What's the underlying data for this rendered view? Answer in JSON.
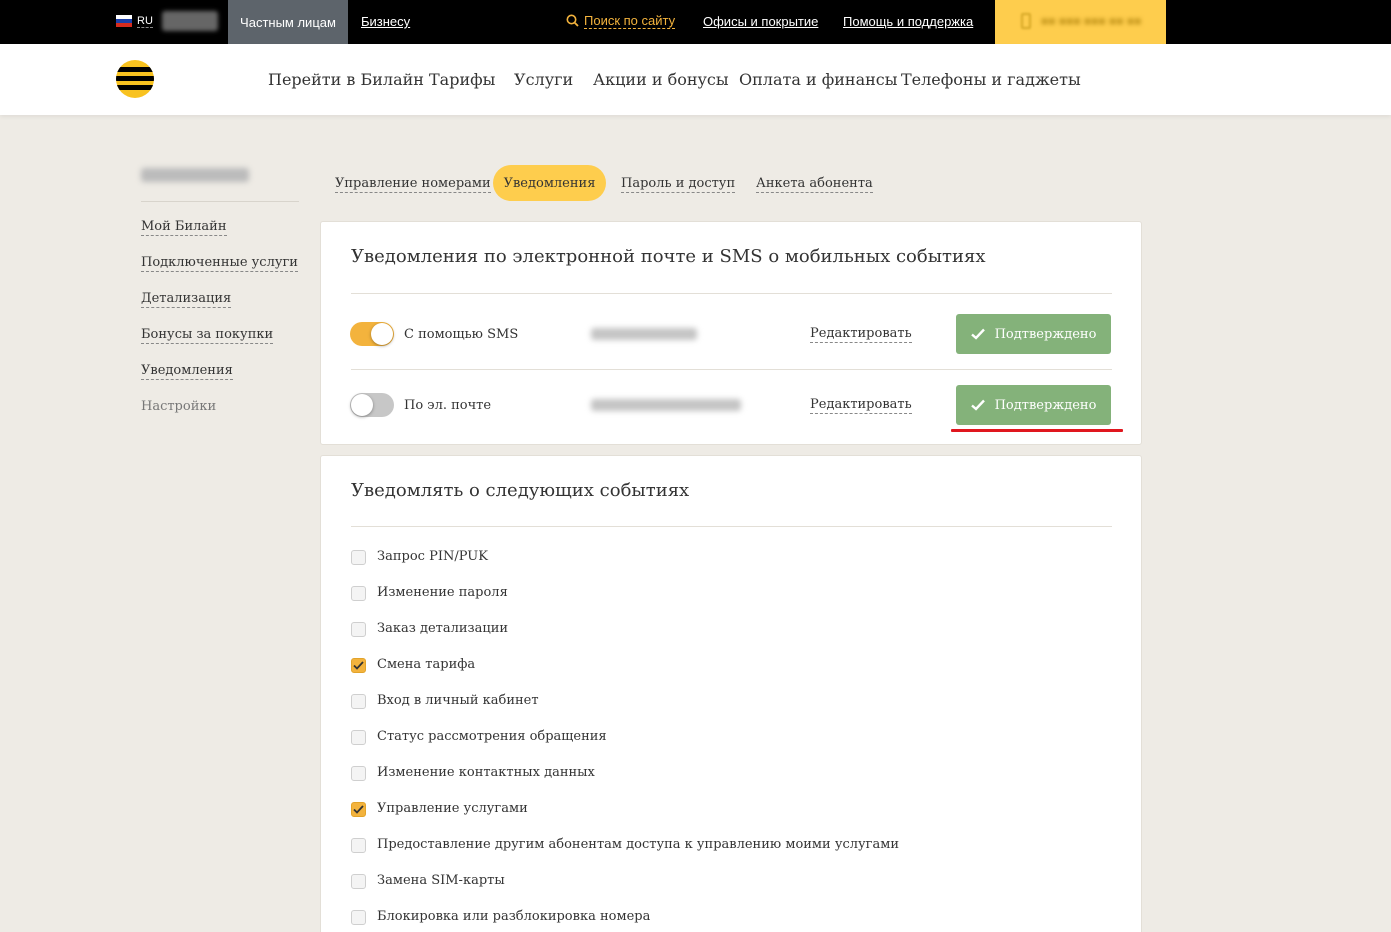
{
  "topbar": {
    "lang": "RU",
    "tab_private": "Частным лицам",
    "tab_business": "Бизнесу",
    "search": "Поиск по сайту",
    "offices": "Офисы и покрытие",
    "help": "Помощь и поддержка"
  },
  "nav": {
    "items": [
      "Перейти в Билайн",
      "Тарифы",
      "Услуги",
      "Акции и бонусы",
      "Оплата и финансы",
      "Телефоны и гаджеты"
    ]
  },
  "sidebar": {
    "items": [
      "Мой Билайн",
      "Подключенные услуги",
      "Детализация",
      "Бонусы за покупки",
      "Уведомления",
      "Настройки"
    ]
  },
  "tabs": [
    "Управление номерами",
    "Уведомления",
    "Пароль и доступ",
    "Анкета абонента"
  ],
  "notify": {
    "title": "Уведомления по электронной почте и SMS о мобильных событиях",
    "rows": [
      {
        "label": "С помощью SMS",
        "edit": "Редактировать",
        "status": "Подтверждено",
        "enabled": true
      },
      {
        "label": "По эл. почте",
        "edit": "Редактировать",
        "status": "Подтверждено",
        "enabled": false
      }
    ]
  },
  "events": {
    "title": "Уведомлять о следующих событиях",
    "items": [
      {
        "label": "Запрос PIN/PUK",
        "checked": false
      },
      {
        "label": "Изменение пароля",
        "checked": false
      },
      {
        "label": "Заказ детализации",
        "checked": false
      },
      {
        "label": "Смена тарифа",
        "checked": true
      },
      {
        "label": "Вход в личный кабинет",
        "checked": false
      },
      {
        "label": "Статус рассмотрения обращения",
        "checked": false
      },
      {
        "label": "Изменение контактных данных",
        "checked": false
      },
      {
        "label": "Управление услугами",
        "checked": true
      },
      {
        "label": "Предоставление другим абонентам доступа к управлению моими услугами",
        "checked": false
      },
      {
        "label": "Замена SIM-карты",
        "checked": false
      },
      {
        "label": "Блокировка или разблокировка номера",
        "checked": false
      }
    ]
  },
  "colors": {
    "accent_yellow": "#fecd4d",
    "confirmed_green": "#84b27a",
    "highlight_red": "#e0161e"
  }
}
